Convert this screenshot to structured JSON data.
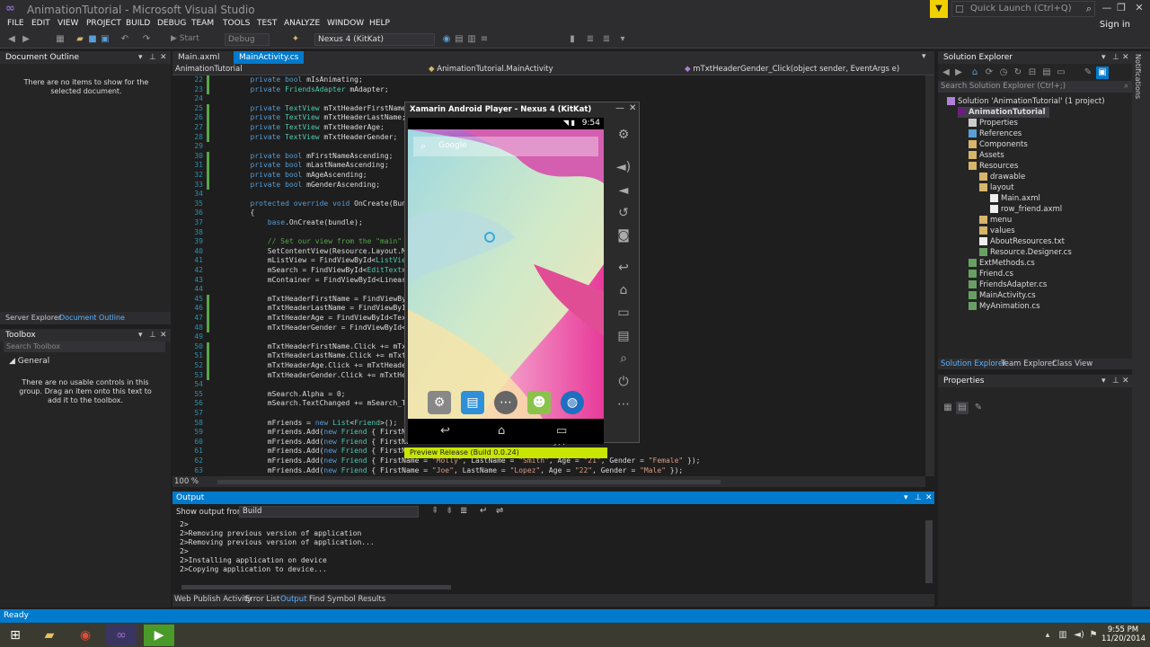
{
  "window": {
    "title": "AnimationTutorial - Microsoft Visual Studio",
    "quick_launch_placeholder": "Quick Launch (Ctrl+Q)",
    "signin": "Sign in"
  },
  "menu": [
    "FILE",
    "EDIT",
    "VIEW",
    "PROJECT",
    "BUILD",
    "DEBUG",
    "TEAM",
    "TOOLS",
    "TEST",
    "ANALYZE",
    "WINDOW",
    "HELP"
  ],
  "toolbar": {
    "start_label": "Start",
    "config": "Debug",
    "device": "Nexus 4 (KitKat)"
  },
  "document_outline": {
    "title": "Document Outline",
    "message": "There are no items to show for the selected document."
  },
  "left_tabs": [
    "Server Explorer",
    "Document Outline"
  ],
  "toolbox": {
    "title": "Toolbox",
    "search_placeholder": "Search Toolbox",
    "group": "General",
    "message": "There are no usable controls in this group. Drag an item onto this text to add it to the toolbox."
  },
  "doc_tabs": [
    "Main.axml",
    "MainActivity.cs"
  ],
  "nav": {
    "project": "AnimationTutorial",
    "type": "AnimationTutorial.MainActivity",
    "member": "mTxtHeaderGender_Click(object sender, EventArgs e)"
  },
  "code": [
    {
      "n": "22",
      "text": "        private bool mIsAnimating;"
    },
    {
      "n": "23",
      "text": "        private FriendsAdapter mAdapter;"
    },
    {
      "n": "24",
      "text": ""
    },
    {
      "n": "25",
      "text": "        private TextView mTxtHeaderFirstName;"
    },
    {
      "n": "26",
      "text": "        private TextView mTxtHeaderLastName;"
    },
    {
      "n": "27",
      "text": "        private TextView mTxtHeaderAge;"
    },
    {
      "n": "28",
      "text": "        private TextView mTxtHeaderGender;"
    },
    {
      "n": "29",
      "text": ""
    },
    {
      "n": "30",
      "text": "        private bool mFirstNameAscending;"
    },
    {
      "n": "31",
      "text": "        private bool mLastNameAscending;"
    },
    {
      "n": "32",
      "text": "        private bool mAgeAscending;"
    },
    {
      "n": "33",
      "text": "        private bool mGenderAscending;"
    },
    {
      "n": "34",
      "text": ""
    },
    {
      "n": "35",
      "text": "        protected override void OnCreate(Bund"
    },
    {
      "n": "36",
      "text": "        {"
    },
    {
      "n": "37",
      "text": "            base.OnCreate(bundle);"
    },
    {
      "n": "38",
      "text": ""
    },
    {
      "n": "39",
      "text": "            // Set our view from the \"main\" l"
    },
    {
      "n": "40",
      "text": "            SetContentView(Resource.Layout.Ma"
    },
    {
      "n": "41",
      "text": "            mListView = FindViewById<ListView"
    },
    {
      "n": "42",
      "text": "            mSearch = FindViewById<EditText>("
    },
    {
      "n": "43",
      "text": "            mContainer = FindViewById<LinearL"
    },
    {
      "n": "44",
      "text": ""
    },
    {
      "n": "45",
      "text": "            mTxtHeaderFirstName = FindViewByI"
    },
    {
      "n": "46",
      "text": "            mTxtHeaderLastName = FindViewById"
    },
    {
      "n": "47",
      "text": "            mTxtHeaderAge = FindViewById<Text"
    },
    {
      "n": "48",
      "text": "            mTxtHeaderGender = FindViewById<T"
    },
    {
      "n": "49",
      "text": ""
    },
    {
      "n": "50",
      "text": "            mTxtHeaderFirstName.Click += mTxt"
    },
    {
      "n": "51",
      "text": "            mTxtHeaderLastName.Click += mTxth"
    },
    {
      "n": "52",
      "text": "            mTxtHeaderAge.Click += mTxtHeader"
    },
    {
      "n": "53",
      "text": "            mTxtHeaderGender.Click += mTxtHea"
    },
    {
      "n": "54",
      "text": ""
    },
    {
      "n": "55",
      "text": "            mSearch.Alpha = 0;"
    },
    {
      "n": "56",
      "text": "            mSearch.TextChanged += mSearch_Te"
    },
    {
      "n": "57",
      "text": ""
    },
    {
      "n": "58",
      "text": "            mFriends = new List<Friend>();"
    },
    {
      "n": "59",
      "text": "            mFriends.Add(new Friend { FirstNa                              e\" });"
    },
    {
      "n": "60",
      "text": "            mFriends.Add(new Friend { FirstNa                              e\" });"
    },
    {
      "n": "61",
      "text": "            mFriends.Add(new Friend { FirstNa                              \"Unknown\" });"
    },
    {
      "n": "62",
      "text": "            mFriends.Add(new Friend { FirstName = \"Molly\", LastName = \"Smith\", Age = \"21\", Gender = \"Female\" });"
    },
    {
      "n": "63",
      "text": "            mFriends.Add(new Friend { FirstName = \"Joe\", LastName = \"Lopez\", Age = \"22\", Gender = \"Male\" });"
    }
  ],
  "zoom": "100 %",
  "emulator": {
    "title": "Xamarin Android Player - Nexus 4 (KitKat)",
    "time": "9:54",
    "search_hint": "Google",
    "release": "Preview Release (Build 0.0.24)"
  },
  "output": {
    "title": "Output",
    "show_label": "Show output from:",
    "source": "Build",
    "lines": [
      "2>",
      "2>Removing previous version of application",
      "2>Removing previous version of application...",
      "2>",
      "2>Installing application on device",
      "2>Copying application to device..."
    ],
    "tabs": [
      "Web Publish Activity",
      "Error List",
      "Output",
      "Find Symbol Results"
    ]
  },
  "solution_explorer": {
    "title": "Solution Explorer",
    "search_placeholder": "Search Solution Explorer (Ctrl+;)",
    "items": [
      {
        "label": "Solution 'AnimationTutorial' (1 project)",
        "depth": 0,
        "kind": "solution"
      },
      {
        "label": "AnimationTutorial",
        "depth": 1,
        "kind": "project"
      },
      {
        "label": "Properties",
        "depth": 2,
        "kind": "props"
      },
      {
        "label": "References",
        "depth": 2,
        "kind": "refs"
      },
      {
        "label": "Components",
        "depth": 2,
        "kind": "folder"
      },
      {
        "label": "Assets",
        "depth": 2,
        "kind": "folder"
      },
      {
        "label": "Resources",
        "depth": 2,
        "kind": "folder"
      },
      {
        "label": "drawable",
        "depth": 3,
        "kind": "folder"
      },
      {
        "label": "layout",
        "depth": 3,
        "kind": "folder"
      },
      {
        "label": "Main.axml",
        "depth": 4,
        "kind": "file"
      },
      {
        "label": "row_friend.axml",
        "depth": 4,
        "kind": "file"
      },
      {
        "label": "menu",
        "depth": 3,
        "kind": "folder"
      },
      {
        "label": "values",
        "depth": 3,
        "kind": "folder"
      },
      {
        "label": "AboutResources.txt",
        "depth": 3,
        "kind": "file"
      },
      {
        "label": "Resource.Designer.cs",
        "depth": 3,
        "kind": "cs"
      },
      {
        "label": "ExtMethods.cs",
        "depth": 2,
        "kind": "cs"
      },
      {
        "label": "Friend.cs",
        "depth": 2,
        "kind": "cs"
      },
      {
        "label": "FriendsAdapter.cs",
        "depth": 2,
        "kind": "cs"
      },
      {
        "label": "MainActivity.cs",
        "depth": 2,
        "kind": "cs"
      },
      {
        "label": "MyAnimation.cs",
        "depth": 2,
        "kind": "cs"
      }
    ],
    "tabs": [
      "Solution Explorer",
      "Team Explorer",
      "Class View"
    ]
  },
  "properties": {
    "title": "Properties"
  },
  "notifications_label": "Notifications",
  "status": "Ready",
  "clock": {
    "time": "9:55 PM",
    "date": "11/20/2014"
  },
  "colors": {
    "accent": "#007acc",
    "release_bar": "#c8e600",
    "change_bar": "#57a64a"
  }
}
